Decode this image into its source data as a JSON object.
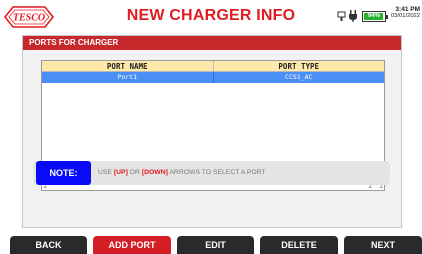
{
  "header": {
    "title": "NEW CHARGER INFO",
    "logo_text": "TESCO",
    "battery_percent": "94%",
    "battery_level": 0.94,
    "time": "3:41 PM",
    "date": "03/01/2022"
  },
  "panel": {
    "title": "PORTS FOR CHARGER",
    "columns": [
      "PORT NAME",
      "PORT TYPE"
    ],
    "rows": [
      {
        "name": "Port1",
        "type": "CCS1_AC"
      }
    ]
  },
  "note": {
    "label": "NOTE:",
    "text_prefix": "USE ",
    "up": "[UP]",
    "mid": " OR ",
    "down": "[DOWN]",
    "text_suffix": " ARROWS TO SELECT A PORT"
  },
  "footer": {
    "back": "BACK",
    "add_port": "ADD PORT",
    "edit": "EDIT",
    "delete": "DELETE",
    "next": "NEXT"
  },
  "colors": {
    "accent_red": "#d41e25",
    "selected_row": "#4a8ff5",
    "note_blue": "#0a0afa"
  }
}
